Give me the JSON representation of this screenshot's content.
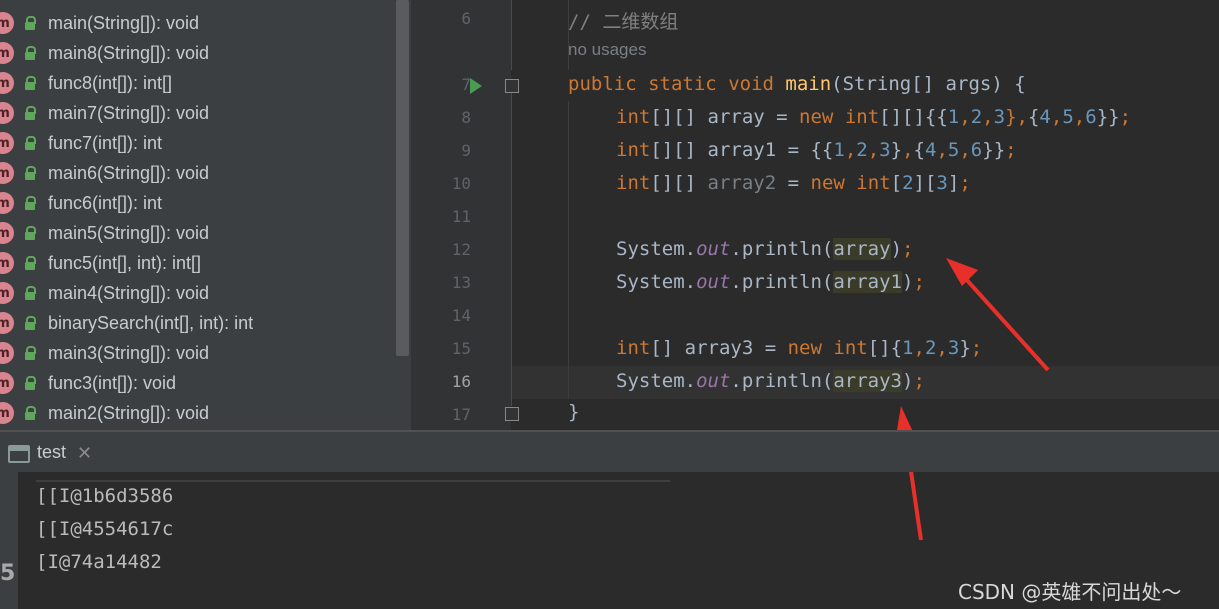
{
  "structure": {
    "items": [
      {
        "label": "main(String[]): void"
      },
      {
        "label": "main8(String[]): void"
      },
      {
        "label": "func8(int[]): int[]"
      },
      {
        "label": "main7(String[]): void"
      },
      {
        "label": "func7(int[]): int"
      },
      {
        "label": "main6(String[]): void"
      },
      {
        "label": "func6(int[]): int"
      },
      {
        "label": "main5(String[]): void"
      },
      {
        "label": "func5(int[], int): int[]"
      },
      {
        "label": "main4(String[]): void"
      },
      {
        "label": "binarySearch(int[], int): int"
      },
      {
        "label": "main3(String[]): void"
      },
      {
        "label": "func3(int[]): void"
      },
      {
        "label": "main2(String[]): void"
      }
    ],
    "method_badge": "m"
  },
  "editor": {
    "line_numbers": [
      "6",
      "7",
      "8",
      "9",
      "10",
      "11",
      "12",
      "13",
      "14",
      "15",
      "16",
      "17"
    ],
    "usage_hint": "no usages",
    "code": {
      "comment": "// 二维数组",
      "l7": [
        "public",
        "static",
        "void",
        "main",
        "(String[] args) {"
      ],
      "l8": [
        "int",
        "[][] array = ",
        "new",
        "int",
        "[][]{{",
        "1",
        ",",
        "2",
        ",",
        "3",
        "},{",
        "4",
        ",",
        "5",
        ",",
        "6",
        "}}",
        ";"
      ],
      "l9": [
        "int",
        "[][] array1 = {{",
        "1",
        ",",
        "2",
        ",",
        "3",
        "},{",
        "4",
        ",",
        "5",
        ",",
        "6",
        "}}",
        ";"
      ],
      "l10": [
        "int",
        "[][] ",
        "array2",
        " = ",
        "new",
        "int",
        "[",
        "2",
        "][",
        "3",
        "]",
        ";"
      ],
      "l12": [
        "System.",
        "out",
        ".println(",
        "array",
        ")",
        ";"
      ],
      "l13": [
        "System.",
        "out",
        ".println(",
        "array1",
        ")",
        ";"
      ],
      "l15": [
        "int",
        "[] array3 = ",
        "new",
        "int",
        "[]{",
        "1",
        ",",
        "2",
        ",",
        "3",
        "}",
        ";"
      ],
      "l16": [
        "System.",
        "out",
        ".println(",
        "array3",
        ")",
        ";"
      ],
      "l17": "}"
    }
  },
  "run_tab": {
    "label": "test",
    "close": "✕"
  },
  "console": {
    "lines": [
      "[[I@1b6d3586",
      "[[I@4554617c",
      "[I@74a14482"
    ]
  },
  "side_digit": "5",
  "watermark": "CSDN @英雄不问出处～",
  "colors": {
    "keyword": "#cc7832",
    "number": "#6897bb",
    "method": "#ffc66d",
    "field": "#9876aa",
    "arrow": "#e8302a"
  }
}
